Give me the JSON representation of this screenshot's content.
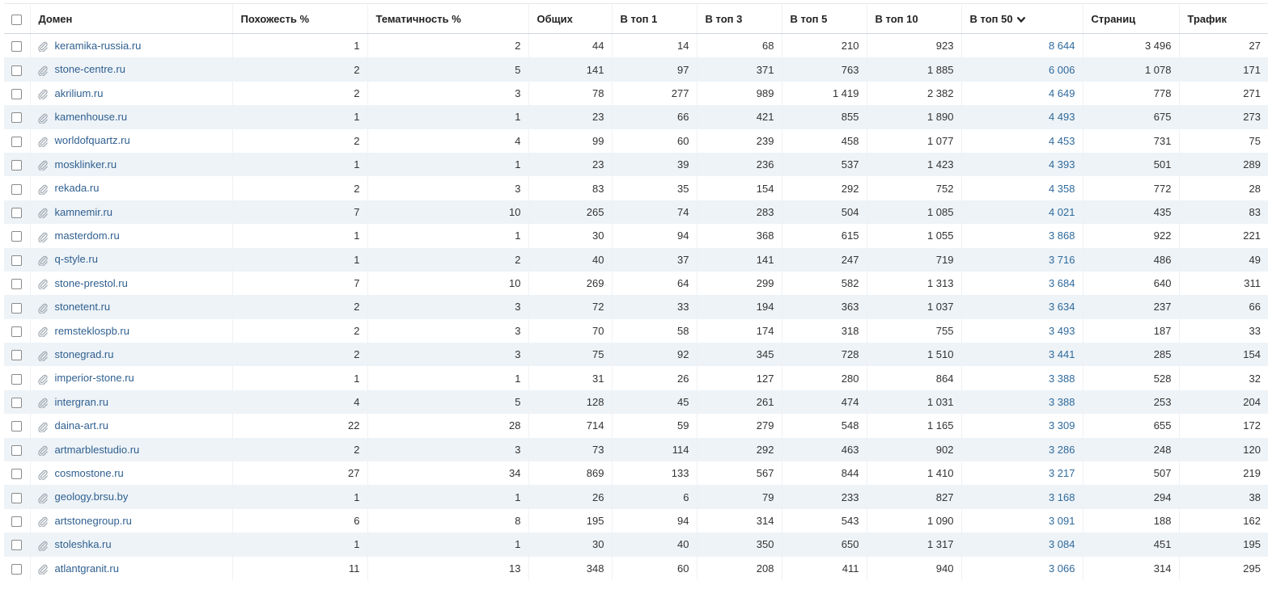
{
  "columns": [
    "Домен",
    "Похожесть %",
    "Тематичность %",
    "Общих",
    "В топ 1",
    "В топ 3",
    "В топ 5",
    "В топ 10",
    "В топ 50",
    "Страниц",
    "Трафик"
  ],
  "sort_icon": "chevron-down-icon",
  "colors": {
    "link": "#2f5f8f",
    "top50": "#2f6a9c",
    "stripe": "#eef3f7"
  },
  "rows": [
    {
      "domain": "keramika-russia.ru",
      "sim": "1",
      "them": "2",
      "common": "44",
      "t1": "14",
      "t3": "68",
      "t5": "210",
      "t10": "923",
      "t50": "8 644",
      "pages": "3 496",
      "traffic": "27"
    },
    {
      "domain": "stone-centre.ru",
      "sim": "2",
      "them": "5",
      "common": "141",
      "t1": "97",
      "t3": "371",
      "t5": "763",
      "t10": "1 885",
      "t50": "6 006",
      "pages": "1 078",
      "traffic": "171"
    },
    {
      "domain": "akrilium.ru",
      "sim": "2",
      "them": "3",
      "common": "78",
      "t1": "277",
      "t3": "989",
      "t5": "1 419",
      "t10": "2 382",
      "t50": "4 649",
      "pages": "778",
      "traffic": "271"
    },
    {
      "domain": "kamenhouse.ru",
      "sim": "1",
      "them": "1",
      "common": "23",
      "t1": "66",
      "t3": "421",
      "t5": "855",
      "t10": "1 890",
      "t50": "4 493",
      "pages": "675",
      "traffic": "273"
    },
    {
      "domain": "worldofquartz.ru",
      "sim": "2",
      "them": "4",
      "common": "99",
      "t1": "60",
      "t3": "239",
      "t5": "458",
      "t10": "1 077",
      "t50": "4 453",
      "pages": "731",
      "traffic": "75"
    },
    {
      "domain": "mosklinker.ru",
      "sim": "1",
      "them": "1",
      "common": "23",
      "t1": "39",
      "t3": "236",
      "t5": "537",
      "t10": "1 423",
      "t50": "4 393",
      "pages": "501",
      "traffic": "289"
    },
    {
      "domain": "rekada.ru",
      "sim": "2",
      "them": "3",
      "common": "83",
      "t1": "35",
      "t3": "154",
      "t5": "292",
      "t10": "752",
      "t50": "4 358",
      "pages": "772",
      "traffic": "28"
    },
    {
      "domain": "kamnemir.ru",
      "sim": "7",
      "them": "10",
      "common": "265",
      "t1": "74",
      "t3": "283",
      "t5": "504",
      "t10": "1 085",
      "t50": "4 021",
      "pages": "435",
      "traffic": "83"
    },
    {
      "domain": "masterdom.ru",
      "sim": "1",
      "them": "1",
      "common": "30",
      "t1": "94",
      "t3": "368",
      "t5": "615",
      "t10": "1 055",
      "t50": "3 868",
      "pages": "922",
      "traffic": "221"
    },
    {
      "domain": "q-style.ru",
      "sim": "1",
      "them": "2",
      "common": "40",
      "t1": "37",
      "t3": "141",
      "t5": "247",
      "t10": "719",
      "t50": "3 716",
      "pages": "486",
      "traffic": "49"
    },
    {
      "domain": "stone-prestol.ru",
      "sim": "7",
      "them": "10",
      "common": "269",
      "t1": "64",
      "t3": "299",
      "t5": "582",
      "t10": "1 313",
      "t50": "3 684",
      "pages": "640",
      "traffic": "311"
    },
    {
      "domain": "stonetent.ru",
      "sim": "2",
      "them": "3",
      "common": "72",
      "t1": "33",
      "t3": "194",
      "t5": "363",
      "t10": "1 037",
      "t50": "3 634",
      "pages": "237",
      "traffic": "66"
    },
    {
      "domain": "remsteklospb.ru",
      "sim": "2",
      "them": "3",
      "common": "70",
      "t1": "58",
      "t3": "174",
      "t5": "318",
      "t10": "755",
      "t50": "3 493",
      "pages": "187",
      "traffic": "33"
    },
    {
      "domain": "stonegrad.ru",
      "sim": "2",
      "them": "3",
      "common": "75",
      "t1": "92",
      "t3": "345",
      "t5": "728",
      "t10": "1 510",
      "t50": "3 441",
      "pages": "285",
      "traffic": "154"
    },
    {
      "domain": "imperior-stone.ru",
      "sim": "1",
      "them": "1",
      "common": "31",
      "t1": "26",
      "t3": "127",
      "t5": "280",
      "t10": "864",
      "t50": "3 388",
      "pages": "528",
      "traffic": "32"
    },
    {
      "domain": "intergran.ru",
      "sim": "4",
      "them": "5",
      "common": "128",
      "t1": "45",
      "t3": "261",
      "t5": "474",
      "t10": "1 031",
      "t50": "3 388",
      "pages": "253",
      "traffic": "204"
    },
    {
      "domain": "daina-art.ru",
      "sim": "22",
      "them": "28",
      "common": "714",
      "t1": "59",
      "t3": "279",
      "t5": "548",
      "t10": "1 165",
      "t50": "3 309",
      "pages": "655",
      "traffic": "172"
    },
    {
      "domain": "artmarblestudio.ru",
      "sim": "2",
      "them": "3",
      "common": "73",
      "t1": "114",
      "t3": "292",
      "t5": "463",
      "t10": "902",
      "t50": "3 286",
      "pages": "248",
      "traffic": "120"
    },
    {
      "domain": "cosmostone.ru",
      "sim": "27",
      "them": "34",
      "common": "869",
      "t1": "133",
      "t3": "567",
      "t5": "844",
      "t10": "1 410",
      "t50": "3 217",
      "pages": "507",
      "traffic": "219"
    },
    {
      "domain": "geology.brsu.by",
      "sim": "1",
      "them": "1",
      "common": "26",
      "t1": "6",
      "t3": "79",
      "t5": "233",
      "t10": "827",
      "t50": "3 168",
      "pages": "294",
      "traffic": "38"
    },
    {
      "domain": "artstonegroup.ru",
      "sim": "6",
      "them": "8",
      "common": "195",
      "t1": "94",
      "t3": "314",
      "t5": "543",
      "t10": "1 090",
      "t50": "3 091",
      "pages": "188",
      "traffic": "162"
    },
    {
      "domain": "stoleshka.ru",
      "sim": "1",
      "them": "1",
      "common": "30",
      "t1": "40",
      "t3": "350",
      "t5": "650",
      "t10": "1 317",
      "t50": "3 084",
      "pages": "451",
      "traffic": "195"
    },
    {
      "domain": "atlantgranit.ru",
      "sim": "11",
      "them": "13",
      "common": "348",
      "t1": "60",
      "t3": "208",
      "t5": "411",
      "t10": "940",
      "t50": "3 066",
      "pages": "314",
      "traffic": "295"
    }
  ]
}
